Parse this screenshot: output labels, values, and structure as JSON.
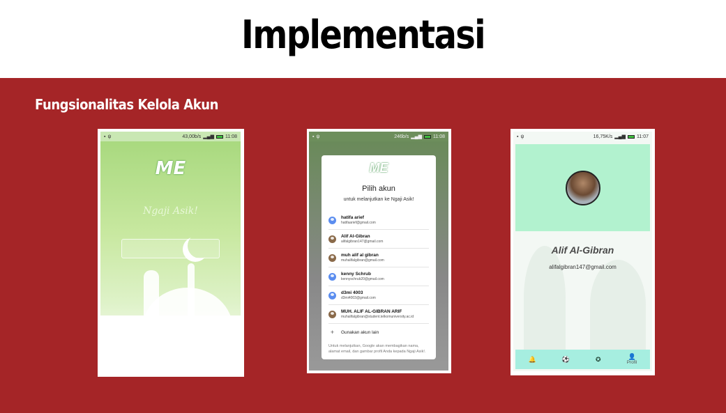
{
  "slide": {
    "title": "Implementasi",
    "subtitle": "Fungsionalitas Kelola Akun"
  },
  "phone1": {
    "status": {
      "speed": "43,00b/s",
      "time": "11:08"
    },
    "logo_mark": "ME",
    "app_name": "Ngaji Asik!"
  },
  "phone2": {
    "status": {
      "speed": "246b/s",
      "time": "11:08"
    },
    "logo_mark": "ME",
    "dialog_title": "Pilih akun",
    "dialog_subtitle": "untuk melanjutkan ke Ngaji Asik!",
    "accounts": [
      {
        "name": "hatifa arief",
        "email": "hatifaarief@gmail.com",
        "avatar": "default"
      },
      {
        "name": "Alif Al-Gibran",
        "email": "alifalgibran147@gmail.com",
        "avatar": "photo"
      },
      {
        "name": "muh alif al gibran",
        "email": "muhalifalgibran@gmail.com",
        "avatar": "photo"
      },
      {
        "name": "kenny Schrub",
        "email": "kennyschrub20@gmail.com",
        "avatar": "default"
      },
      {
        "name": "d3mi 4003",
        "email": "d3mi4003@gmail.com",
        "avatar": "default"
      },
      {
        "name": "MUH. ALIF AL-GIBRAN ARIF",
        "email": "muhalifalgibran@student.telkomuniversity.ac.id",
        "avatar": "photo"
      }
    ],
    "use_other": "Gunakan akun lain",
    "footer": "Untuk melanjutkan, Google akan membagikan nama, alamat email, dan gambar profil Anda kepada Ngaji Asik!."
  },
  "phone3": {
    "status": {
      "speed": "16,75K/s",
      "time": "11:07"
    },
    "name": "Alif Al-Gibran",
    "email": "alifalgibran147@gmail.com",
    "nav": [
      {
        "icon": "bell-icon",
        "glyph": "🔔",
        "label": ""
      },
      {
        "icon": "soccer-icon",
        "glyph": "⚽",
        "label": ""
      },
      {
        "icon": "star-icon",
        "glyph": "✪",
        "label": ""
      },
      {
        "icon": "person-icon",
        "glyph": "👤",
        "label": "Profil"
      }
    ]
  },
  "colors": {
    "slide_red": "#a52527",
    "profile_header": "#b2f2cf",
    "bottom_nav": "#a6eee0"
  }
}
